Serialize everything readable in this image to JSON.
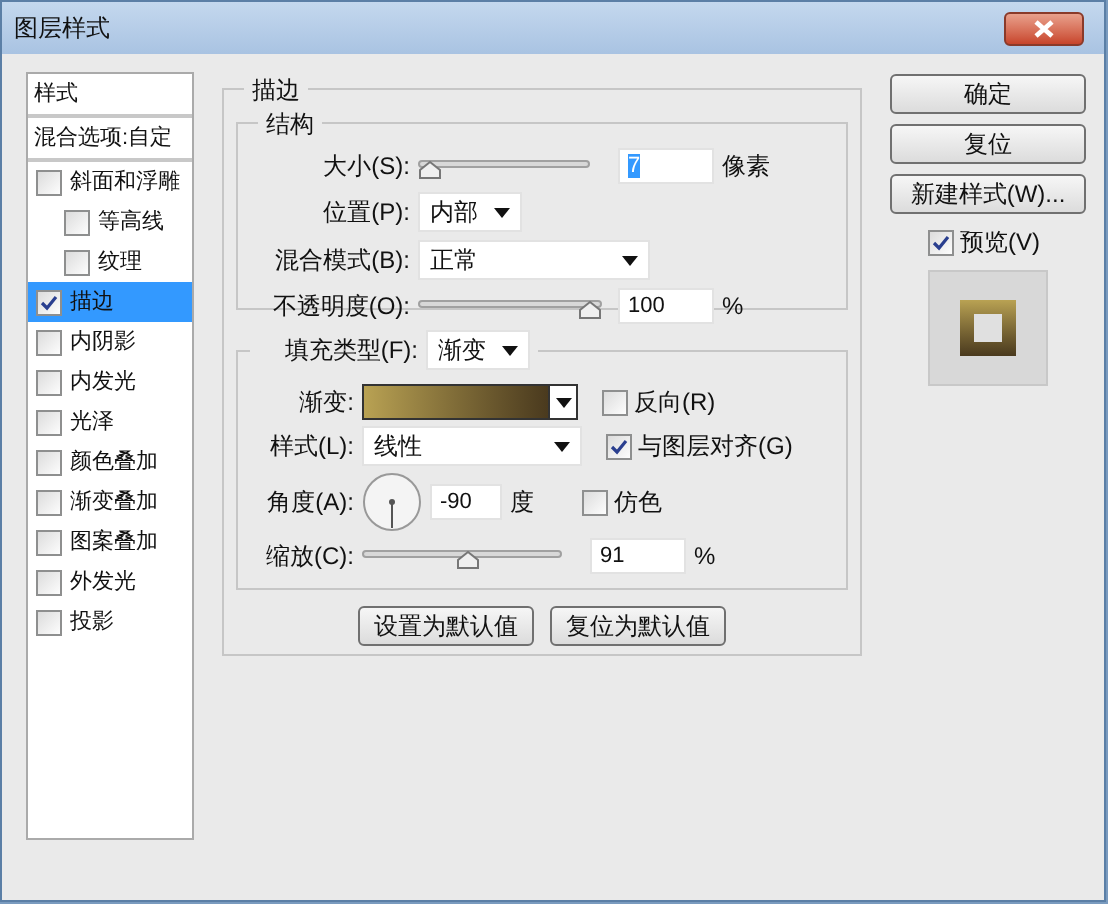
{
  "window": {
    "title": "图层样式"
  },
  "sidebar": {
    "items": [
      {
        "kind": "header",
        "label": "样式",
        "selected": false
      },
      {
        "kind": "header",
        "label": "混合选项:自定",
        "selected": false
      },
      {
        "kind": "checkbox",
        "label": "斜面和浮雕",
        "checked": false,
        "selected": false,
        "children": [
          {
            "kind": "checkbox",
            "label": "等高线",
            "checked": false,
            "selected": false
          },
          {
            "kind": "checkbox",
            "label": "纹理",
            "checked": false,
            "selected": false
          }
        ]
      },
      {
        "kind": "checkbox",
        "label": "描边",
        "checked": true,
        "selected": true
      },
      {
        "kind": "checkbox",
        "label": "内阴影",
        "checked": false,
        "selected": false
      },
      {
        "kind": "checkbox",
        "label": "内发光",
        "checked": false,
        "selected": false
      },
      {
        "kind": "checkbox",
        "label": "光泽",
        "checked": false,
        "selected": false
      },
      {
        "kind": "checkbox",
        "label": "颜色叠加",
        "checked": false,
        "selected": false
      },
      {
        "kind": "checkbox",
        "label": "渐变叠加",
        "checked": false,
        "selected": false
      },
      {
        "kind": "checkbox",
        "label": "图案叠加",
        "checked": false,
        "selected": false
      },
      {
        "kind": "checkbox",
        "label": "外发光",
        "checked": false,
        "selected": false
      },
      {
        "kind": "checkbox",
        "label": "投影",
        "checked": false,
        "selected": false
      }
    ]
  },
  "stroke": {
    "title": "描边",
    "structure": {
      "title": "结构",
      "size": {
        "label": "大小(S):",
        "level": 0.0,
        "value": "7",
        "unit": "像素"
      },
      "position": {
        "label": "位置(P):",
        "value": "内部"
      },
      "blend_mode": {
        "label": "混合模式(B):",
        "value": "正常"
      },
      "opacity": {
        "label": "不透明度(O):",
        "level": 1.0,
        "value": "100",
        "unit": "%"
      }
    },
    "fill": {
      "label": "填充类型(F):",
      "value": "渐变",
      "gradient": {
        "label": "渐变:"
      },
      "reverse": {
        "label": "反向(R)",
        "checked": false
      },
      "style": {
        "label": "样式(L):",
        "value": "线性"
      },
      "align": {
        "label": "与图层对齐(G)",
        "checked": true
      },
      "angle": {
        "label": "角度(A):",
        "value": "-90",
        "unit": "度"
      },
      "dither": {
        "label": "仿色",
        "checked": false
      },
      "scale": {
        "label": "缩放(C):",
        "level": 0.53,
        "value": "91",
        "unit": "%"
      }
    },
    "buttons": [
      "设置为默认值",
      "复位为默认值"
    ]
  },
  "actions": {
    "buttons": [
      "确定",
      "复位",
      "新建样式(W)..."
    ],
    "preview": {
      "label": "预览(V)",
      "checked": true
    }
  }
}
